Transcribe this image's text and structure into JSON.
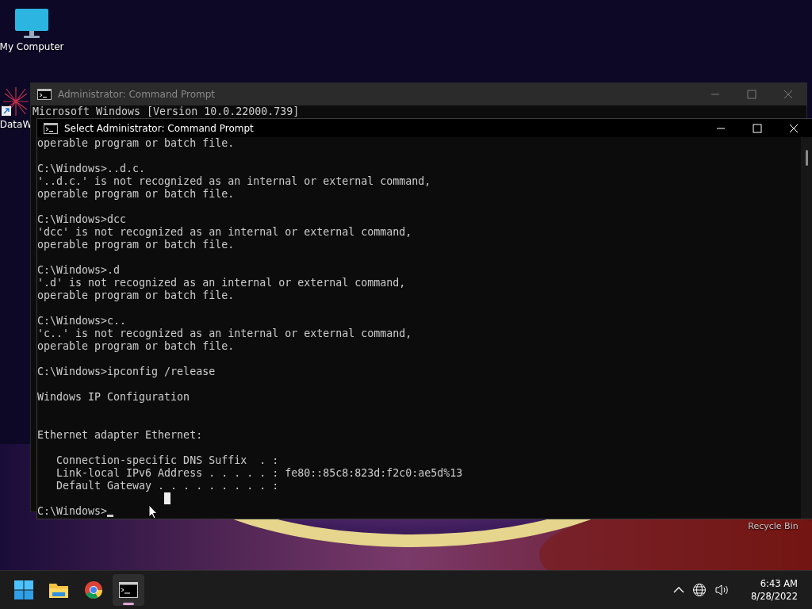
{
  "desktop_icons": [
    {
      "kind": "computer",
      "label": "My Computer"
    },
    {
      "kind": "shortcut",
      "label": "DataW"
    },
    {
      "kind": "recycle",
      "label": "Recycle Bin"
    }
  ],
  "back_window": {
    "title": "Administrator: Command Prompt",
    "first_line": "Microsoft Windows [Version 10.0.22000.739]"
  },
  "front_window": {
    "title": "Select Administrator: Command Prompt",
    "lines": [
      {
        "text": "operable program or batch file."
      },
      {
        "kind": "blank"
      },
      {
        "text": "C:\\Windows>..d.c."
      },
      {
        "text": "'..d.c.' is not recognized as an internal or external command,"
      },
      {
        "text": "operable program or batch file."
      },
      {
        "kind": "blank"
      },
      {
        "text": "C:\\Windows>dcc"
      },
      {
        "text": "'dcc' is not recognized as an internal or external command,"
      },
      {
        "text": "operable program or batch file."
      },
      {
        "kind": "blank"
      },
      {
        "text": "C:\\Windows>.d"
      },
      {
        "text": "'.d' is not recognized as an internal or external command,"
      },
      {
        "text": "operable program or batch file."
      },
      {
        "kind": "blank"
      },
      {
        "text": "C:\\Windows>c.."
      },
      {
        "text": "'c..' is not recognized as an internal or external command,"
      },
      {
        "text": "operable program or batch file."
      },
      {
        "kind": "blank"
      },
      {
        "text": "C:\\Windows>ipconfig /release"
      },
      {
        "kind": "blank"
      },
      {
        "text": "Windows IP Configuration"
      },
      {
        "kind": "blank"
      },
      {
        "kind": "blank"
      },
      {
        "text": "Ethernet adapter Ethernet:"
      },
      {
        "kind": "blank"
      },
      {
        "text": "   Connection-specific DNS Suffix  . :"
      },
      {
        "text": "   Link-local IPv6 Address . . . . . : fe80::85c8:823d:f2c0:ae5d%13"
      },
      {
        "text": "   Default Gateway . . . . . . . . . :"
      },
      {
        "kind": "blank"
      },
      {
        "text": "C:\\Windows>",
        "kind": "prompt"
      }
    ]
  },
  "taskbar": {
    "apps": [
      {
        "kind": "start",
        "selected": false
      },
      {
        "kind": "explorer",
        "selected": false
      },
      {
        "kind": "browser",
        "selected": false
      },
      {
        "kind": "terminal",
        "selected": true
      }
    ],
    "time": "6:43 AM",
    "date": "8/28/2022"
  }
}
